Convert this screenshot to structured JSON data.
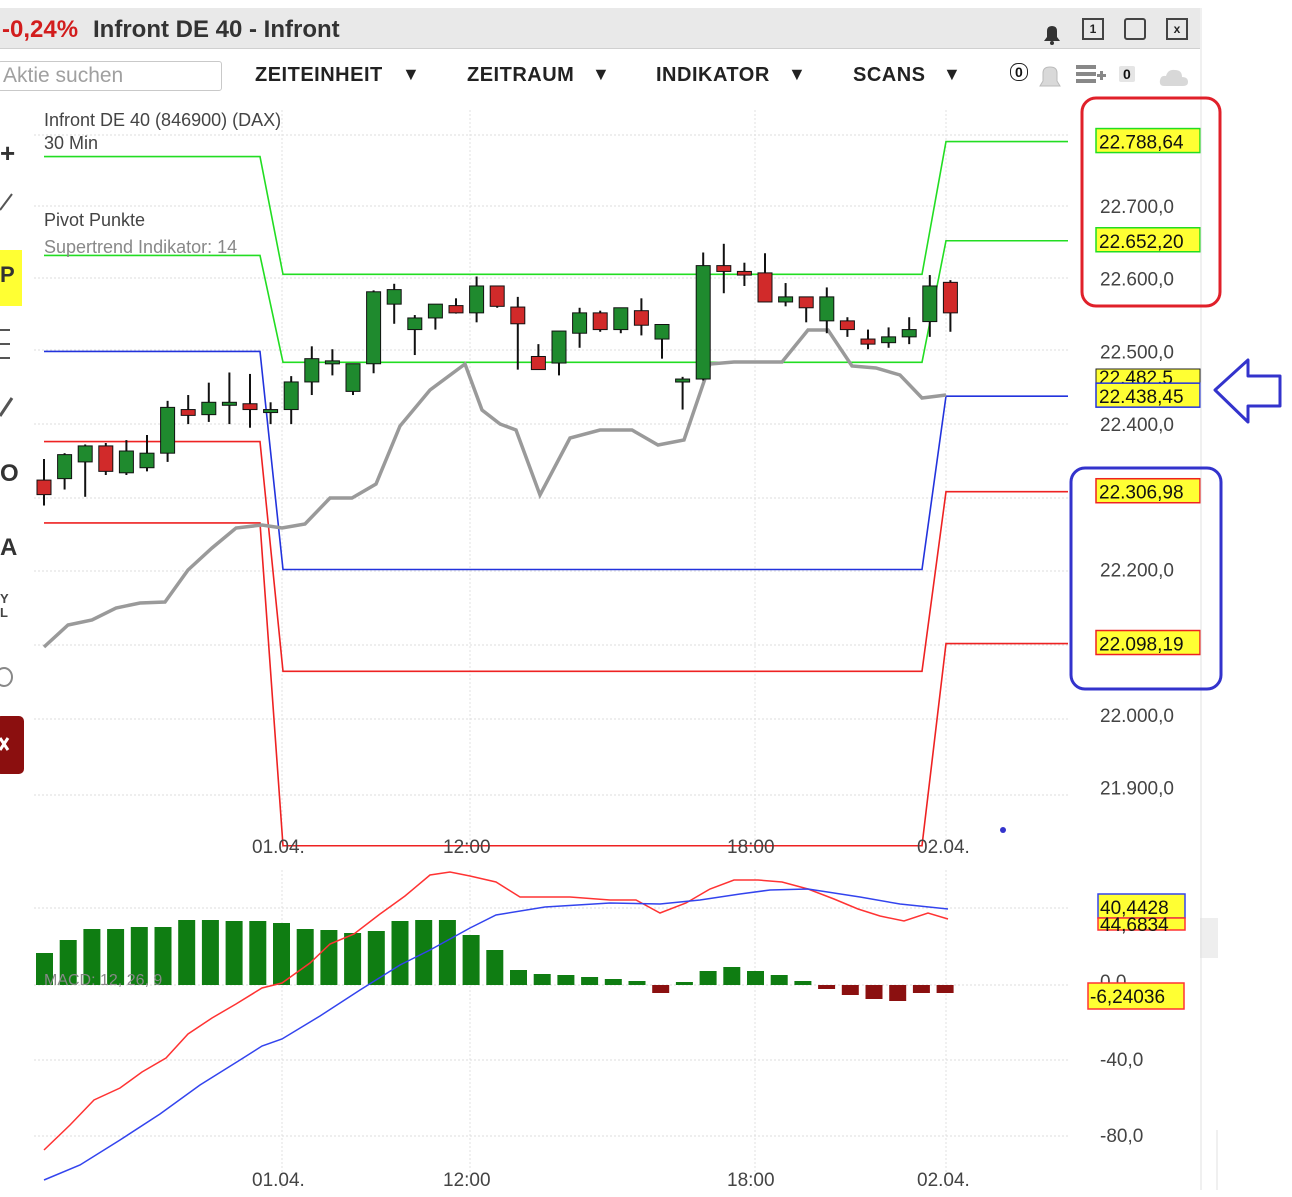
{
  "window": {
    "change": "-0,24%",
    "title": "Infront DE 40 - Infront",
    "controls": [
      "1",
      "x"
    ]
  },
  "toolbar": {
    "search_placeholder": "Aktie suchen",
    "menus": [
      "ZEITEINHEIT",
      "ZEITRAUM",
      "INDIKATOR",
      "SCANS"
    ],
    "alert_count": "0",
    "notes_count": "0"
  },
  "sidebar": {
    "tools": [
      "+",
      "P",
      "O",
      "A",
      "Y",
      "L"
    ]
  },
  "chart_info": {
    "instrument": "Infront DE 40 (846900) (DAX)",
    "interval": "30 Min",
    "indicator_1": "Pivot Punkte",
    "indicator_2": "Supertrend Indikator: 14",
    "macd_label": "MACD: 12, 26, 9"
  },
  "colors": {
    "up_candle": "#1f8a2e",
    "down_candle": "#d12a2a",
    "resistance": "#22dd22",
    "pivot": "#2233dd",
    "support": "#ee2222",
    "supertrend": "#9a9a9a",
    "macd_line": "#3344ee",
    "signal_line": "#ff3333",
    "hist_up": "#0f7d12",
    "hist_down": "#8b1010",
    "highlight_yellow": "#ffff33",
    "annotation_red": "#e0202a",
    "annotation_blue": "#3333cc"
  },
  "chart_data": [
    {
      "type": "candlestick",
      "name": "price",
      "y_ticks": [
        "22.700,0",
        "22.600,0",
        "22.500,0",
        "22.400,0",
        "22.200,0",
        "22.000,0",
        "21.900,0"
      ],
      "y_tick_values": [
        22700,
        22600,
        22500,
        22400,
        22200,
        22000,
        21900
      ],
      "x_ticks": [
        "01.04.",
        "12:00",
        "18:00",
        "02.04."
      ],
      "ylim": [
        21832,
        22855
      ],
      "candles": [
        {
          "o": 22323,
          "h": 22352,
          "l": 22288,
          "c": 22303
        },
        {
          "o": 22325,
          "h": 22360,
          "l": 22310,
          "c": 22358
        },
        {
          "o": 22348,
          "h": 22372,
          "l": 22300,
          "c": 22370
        },
        {
          "o": 22370,
          "h": 22374,
          "l": 22330,
          "c": 22335
        },
        {
          "o": 22333,
          "h": 22378,
          "l": 22330,
          "c": 22363
        },
        {
          "o": 22340,
          "h": 22385,
          "l": 22335,
          "c": 22360
        },
        {
          "o": 22360,
          "h": 22432,
          "l": 22348,
          "c": 22423
        },
        {
          "o": 22420,
          "h": 22440,
          "l": 22400,
          "c": 22412
        },
        {
          "o": 22413,
          "h": 22457,
          "l": 22403,
          "c": 22430
        },
        {
          "o": 22430,
          "h": 22471,
          "l": 22400,
          "c": 22430
        },
        {
          "o": 22428,
          "h": 22469,
          "l": 22395,
          "c": 22420
        },
        {
          "o": 22420,
          "h": 22430,
          "l": 22400,
          "c": 22420
        },
        {
          "o": 22420,
          "h": 22466,
          "l": 22400,
          "c": 22458
        },
        {
          "o": 22458,
          "h": 22507,
          "l": 22440,
          "c": 22490
        },
        {
          "o": 22485,
          "h": 22503,
          "l": 22467,
          "c": 22487
        },
        {
          "o": 22445,
          "h": 22464,
          "l": 22440,
          "c": 22483
        },
        {
          "o": 22483,
          "h": 22584,
          "l": 22470,
          "c": 22582
        },
        {
          "o": 22565,
          "h": 22593,
          "l": 22538,
          "c": 22585
        },
        {
          "o": 22530,
          "h": 22550,
          "l": 22495,
          "c": 22546
        },
        {
          "o": 22546,
          "h": 22563,
          "l": 22530,
          "c": 22565
        },
        {
          "o": 22563,
          "h": 22573,
          "l": 22552,
          "c": 22553
        },
        {
          "o": 22553,
          "h": 22603,
          "l": 22540,
          "c": 22590
        },
        {
          "o": 22590,
          "h": 22583,
          "l": 22560,
          "c": 22562
        },
        {
          "o": 22561,
          "h": 22575,
          "l": 22475,
          "c": 22538
        },
        {
          "o": 22493,
          "h": 22510,
          "l": 22480,
          "c": 22475
        },
        {
          "o": 22484,
          "h": 22520,
          "l": 22467,
          "c": 22528
        },
        {
          "o": 22525,
          "h": 22560,
          "l": 22505,
          "c": 22553
        },
        {
          "o": 22553,
          "h": 22556,
          "l": 22527,
          "c": 22530
        },
        {
          "o": 22530,
          "h": 22556,
          "l": 22525,
          "c": 22560
        },
        {
          "o": 22556,
          "h": 22573,
          "l": 22522,
          "c": 22536
        },
        {
          "o": 22517,
          "h": 22513,
          "l": 22490,
          "c": 22537
        },
        {
          "o": 22462,
          "h": 22465,
          "l": 22420,
          "c": 22462
        },
        {
          "o": 22462,
          "h": 22636,
          "l": 22460,
          "c": 22618
        },
        {
          "o": 22618,
          "h": 22648,
          "l": 22580,
          "c": 22610
        },
        {
          "o": 22610,
          "h": 22622,
          "l": 22590,
          "c": 22605
        },
        {
          "o": 22608,
          "h": 22635,
          "l": 22572,
          "c": 22568
        },
        {
          "o": 22568,
          "h": 22594,
          "l": 22562,
          "c": 22575
        },
        {
          "o": 22575,
          "h": 22562,
          "l": 22540,
          "c": 22560
        },
        {
          "o": 22542,
          "h": 22588,
          "l": 22525,
          "c": 22575
        },
        {
          "o": 22542,
          "h": 22547,
          "l": 22520,
          "c": 22530
        },
        {
          "o": 22517,
          "h": 22530,
          "l": 22503,
          "c": 22510
        },
        {
          "o": 22512,
          "h": 22533,
          "l": 22505,
          "c": 22520
        },
        {
          "o": 22520,
          "h": 22547,
          "l": 22510,
          "c": 22530
        },
        {
          "o": 22541,
          "h": 22605,
          "l": 22520,
          "c": 22590
        },
        {
          "o": 22595,
          "h": 22598,
          "l": 22527,
          "c": 22553
        }
      ],
      "levels": {
        "R2": {
          "label": "22.788,64",
          "before": 22740,
          "after": 22788.64
        },
        "R1": {
          "label": "22.652,20",
          "before": 22605,
          "after": 22652.2
        },
        "R1_prev": {
          "before": 22675
        },
        "P": {
          "label": "22.438,45",
          "before": 22488,
          "after": 22438.45
        },
        "S1": {
          "label": "22.306,98",
          "before": 22312,
          "after": 22306.98
        },
        "S2": {
          "label": "22.098,19",
          "before": 22256,
          "after": 22098.19
        }
      },
      "current_price_label": "22.482,5"
    },
    {
      "type": "macd",
      "name": "macd",
      "macd_value": "40,4428",
      "hist_value": "-6,24036",
      "signal_hidden": "44,6834",
      "y_ticks": [
        "0,0",
        "-40,0",
        "-80,0"
      ],
      "x_ticks": [
        "01.04.",
        "12:00",
        "18:00",
        "02.04."
      ]
    }
  ],
  "annotations": {
    "red_box": "upper resistance levels",
    "blue_box": "lower support levels",
    "arrow": "pivot level"
  }
}
